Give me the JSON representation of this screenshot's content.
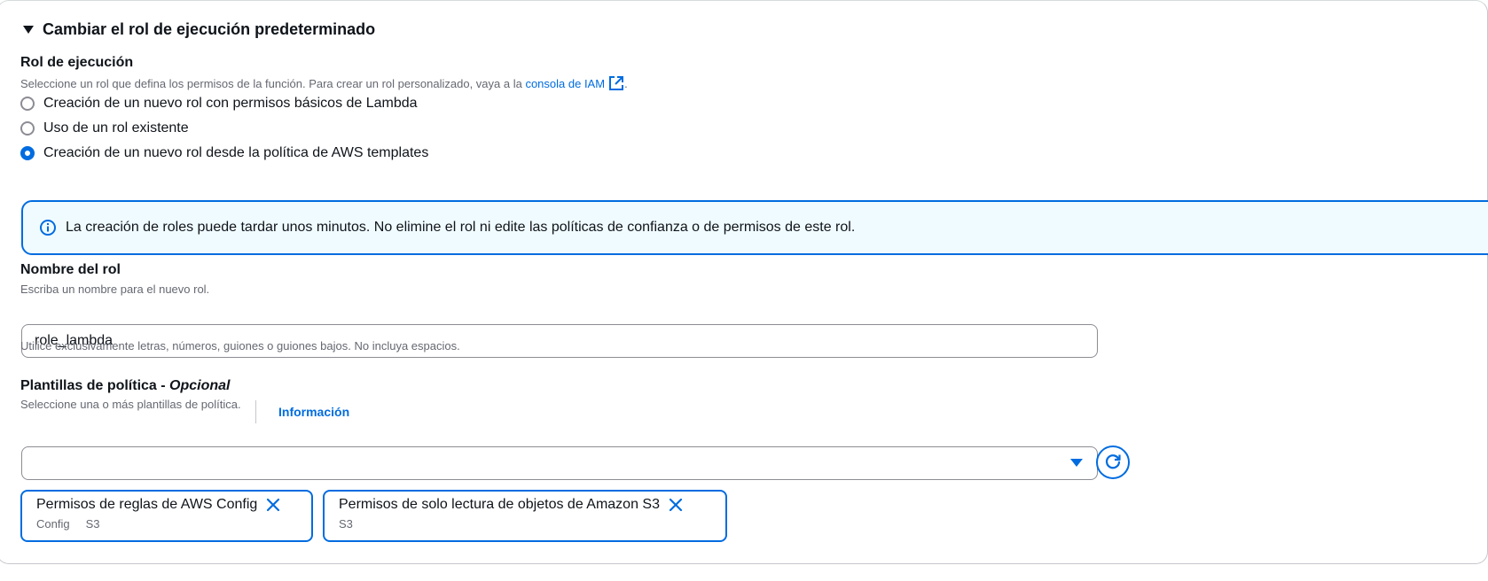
{
  "section": {
    "title": "Cambiar el rol de ejecución predeterminado"
  },
  "execution_role": {
    "label": "Rol de ejecución",
    "description_prefix": "Seleccione un rol que defina los permisos de la función. Para crear un rol personalizado, vaya a la ",
    "link_text": "consola de IAM",
    "description_suffix": ".",
    "options": [
      {
        "label": "Creación de un nuevo rol con permisos básicos de Lambda",
        "checked": false
      },
      {
        "label": "Uso de un rol existente",
        "checked": false
      },
      {
        "label": "Creación de un nuevo rol desde la política de AWS templates",
        "checked": true
      }
    ]
  },
  "alert": {
    "text": "La creación de roles puede tardar unos minutos. No elimine el rol ni edite las políticas de confianza o de permisos de este rol."
  },
  "role_name": {
    "label": "Nombre del rol",
    "description": "Escriba un nombre para el nuevo rol.",
    "value": "role_lambda",
    "constraint": "Utilice exclusivamente letras, números, guiones o guiones bajos. No incluya espacios."
  },
  "policy_templates": {
    "label": "Plantillas de política - ",
    "optional": "Opcional",
    "info_link": "Información",
    "description": "Seleccione una o más plantillas de política.",
    "selected_value": "",
    "tokens": [
      {
        "title": "Permisos de reglas de AWS Config",
        "tags": [
          "Config",
          "S3"
        ]
      },
      {
        "title": "Permisos de solo lectura de objetos de Amazon S3",
        "tags": [
          "S3"
        ]
      }
    ]
  },
  "colors": {
    "accent": "#006ce0",
    "alert_bg": "#f0fbff",
    "text": "#0f141a",
    "muted": "#656871"
  }
}
